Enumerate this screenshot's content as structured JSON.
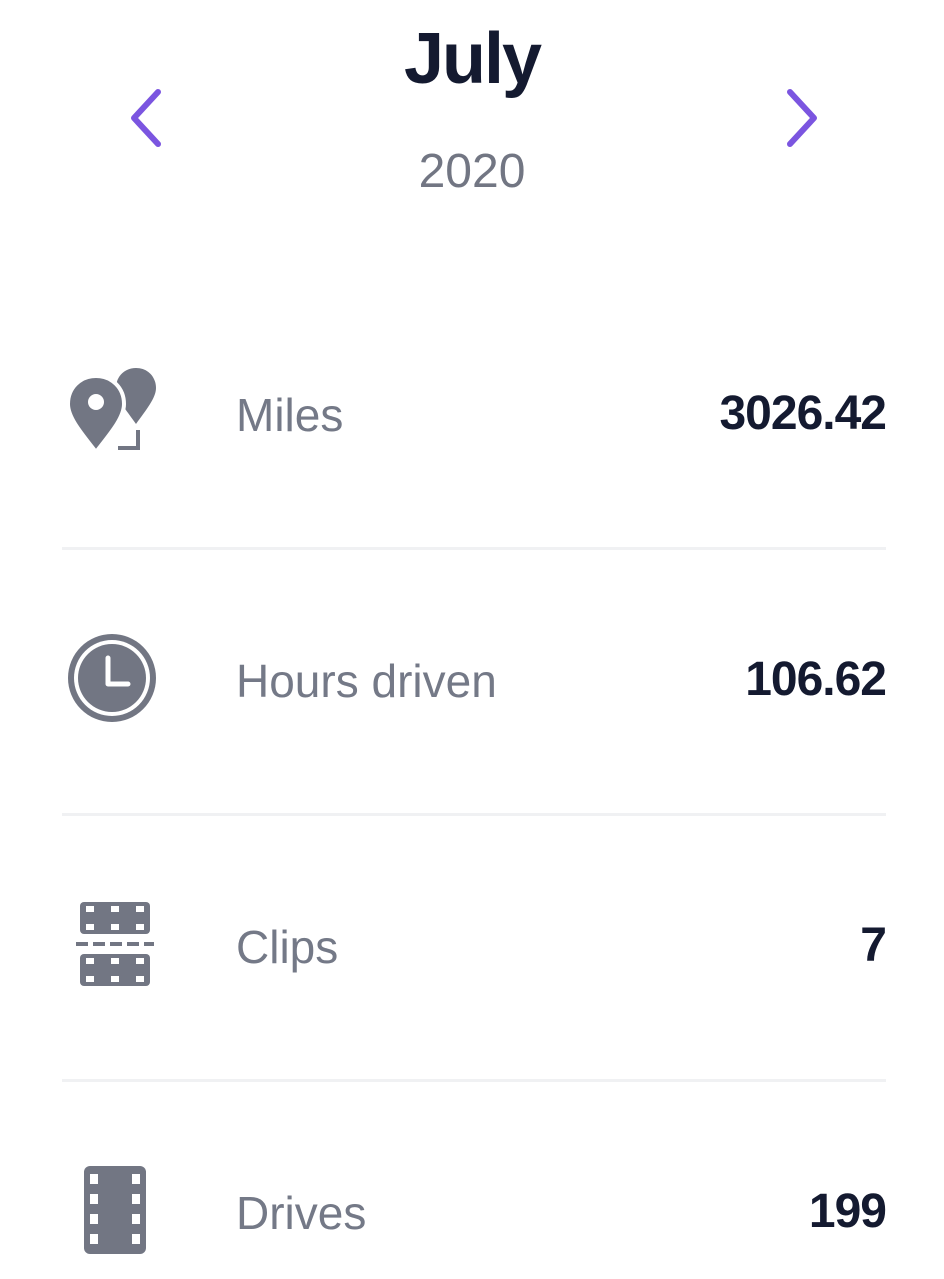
{
  "period": {
    "month": "July",
    "year": "2020"
  },
  "nav": {
    "prev_icon": "chevron-left-icon",
    "next_icon": "chevron-right-icon",
    "accent_color": "#7b55e0"
  },
  "stats": [
    {
      "label": "Miles",
      "value": "3026.42",
      "icon": "map-pin-icon"
    },
    {
      "label": "Hours driven",
      "value": "106.62",
      "icon": "clock-icon"
    },
    {
      "label": "Clips",
      "value": "7",
      "icon": "clip-icon"
    },
    {
      "label": "Drives",
      "value": "199",
      "icon": "film-icon"
    }
  ],
  "colors": {
    "title": "#141a30",
    "muted": "#747987",
    "icon": "#727683",
    "divider": "#f0f1f3"
  }
}
